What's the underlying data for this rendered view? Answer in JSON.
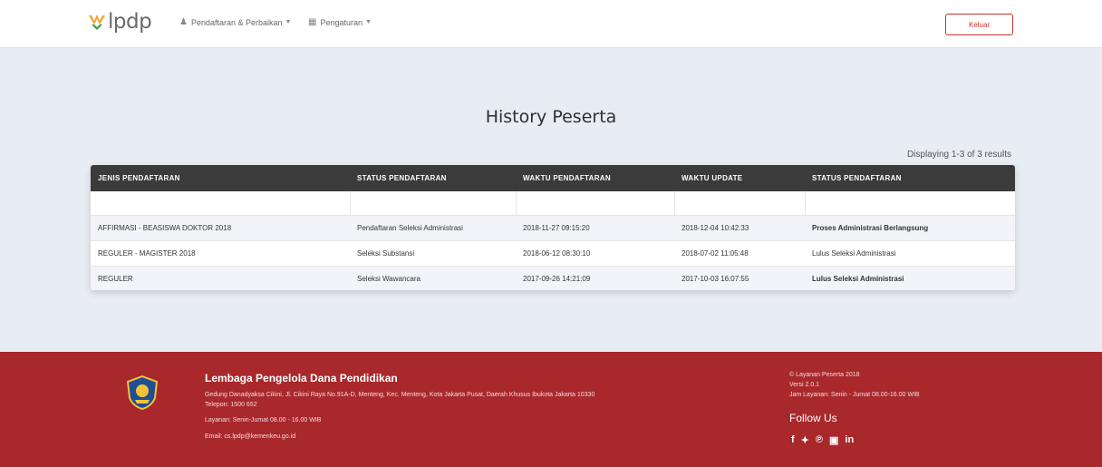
{
  "navbar": {
    "logo_text": "lpdp",
    "menu_1": "Pendaftaran & Perbaikan",
    "menu_2": "Pengaturan",
    "logout": "Keluar"
  },
  "main": {
    "title": "History Peserta",
    "displaying": "Displaying 1-3 of 3 results"
  },
  "table": {
    "headers": [
      "JENIS PENDAFTARAN",
      "STATUS PENDAFTARAN",
      "WAKTU PENDAFTARAN",
      "WAKTU UPDATE",
      "STATUS PENDAFTARAN"
    ],
    "rows": [
      [
        "AFFIRMASI - BEASISWA DOKTOR 2018",
        "Pendaftaran Seleksi Administrasi",
        "2018-11-27 09:15:20",
        "2018-12-04 10:42:33",
        "Proses Administrasi Berlangsung"
      ],
      [
        "REGULER - MAGISTER 2018",
        "Seleksi Substansi",
        "2018-06-12 08:30:10",
        "2018-07-02 11:05:48",
        "Lulus Seleksi Administrasi"
      ],
      [
        "REGULER",
        "Seleksi Wawancara",
        "2017-09-26 14:21:09",
        "2017-10-03 16:07:55",
        "Lulus Seleksi Administrasi"
      ]
    ]
  },
  "footer": {
    "org_name": "Lembaga Pengelola Dana Pendidikan",
    "address": "Gedung Danadyaksa Cikini, Jl. Cikini Raya No.91A-D, Menteng, Kec. Menteng, Kota Jakarta Pusat, Daerah Khusus Ibukota Jakarta 10330",
    "phone": "Telepon: 1500 652",
    "hours": "Layanan: Senin-Jumat 08.00 - 16.00 WIB",
    "email": "Email: cs.lpdp@kemenkeu.go.id",
    "right_1": "© Layanan Peserta 2018",
    "right_2": "Versi 2.0.1",
    "right_3": "Jam Layanan: Senin - Jumat 08.00-16.00 WIB",
    "follow_us": "Follow Us",
    "social_icons": [
      "facebook-icon",
      "twitter-icon",
      "pinterest-icon",
      "instagram-icon",
      "linkedin-icon"
    ]
  },
  "colors": {
    "footer_bg": "#a8282c",
    "table_header_bg": "#3b3b3b",
    "page_bg": "#e8ecf3",
    "link": "#2a6fc1",
    "logout_border": "#c9302c"
  }
}
